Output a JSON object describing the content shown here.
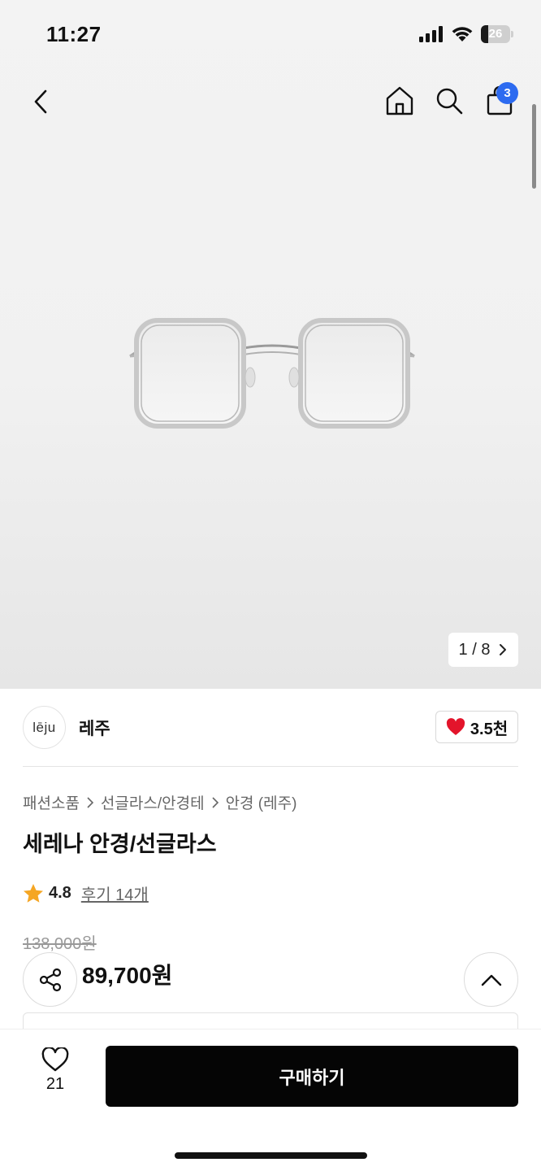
{
  "status_bar": {
    "time": "11:27",
    "battery": "26",
    "battery_level": 0.26
  },
  "header": {
    "icons": [
      "back-icon",
      "home-icon",
      "search-icon",
      "bag-icon"
    ],
    "cart_badge": "3"
  },
  "gallery": {
    "pager": "1 / 8"
  },
  "seller": {
    "logo_text": "lēju",
    "name": "레주",
    "likes": "3.5천"
  },
  "product": {
    "breadcrumb": [
      "패션소품",
      "선글라스/안경테",
      "안경 (레주)"
    ],
    "title": "세레나 안경/선글라스",
    "rating": "4.8",
    "reviews": "후기 14개",
    "original_price": "138,000원",
    "sale_price": "89,700원"
  },
  "bottom_bar": {
    "wish_count": "21",
    "buy_label": "구매하기"
  },
  "colors": {
    "badge": "#2d6bf0",
    "heart": "#e3142b",
    "star": "#f5a623",
    "buy_button": "#050505"
  }
}
